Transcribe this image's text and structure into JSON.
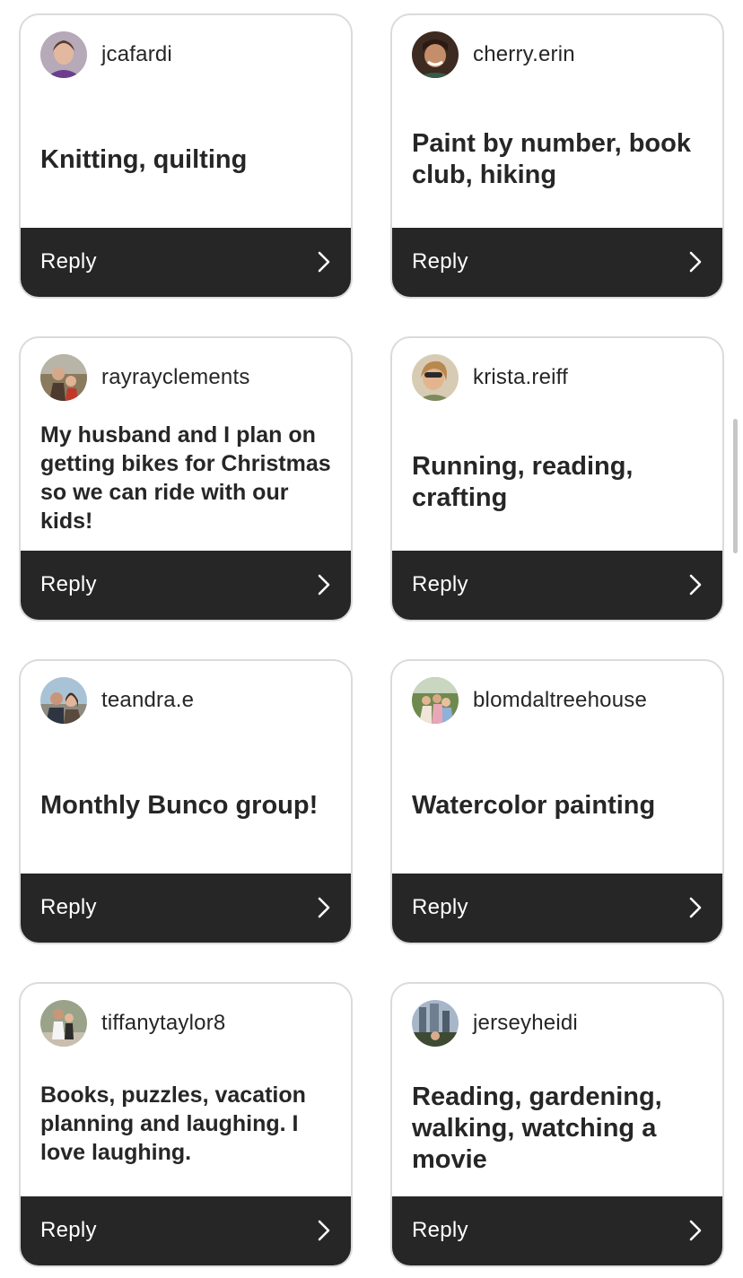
{
  "reply_label": "Reply",
  "colors": {
    "reply_bar": "#262626",
    "card_border": "#dbdbdb",
    "text": "#262626"
  },
  "cards": [
    {
      "username": "jcafardi",
      "message": "Knitting, quilting",
      "avatar_icon": "user-avatar"
    },
    {
      "username": "cherry.erin",
      "message": "Paint by number, book club, hiking",
      "avatar_icon": "user-avatar"
    },
    {
      "username": "rayrayclements",
      "message": "My husband and I plan on getting bikes for Christmas so we can ride with our kids!",
      "avatar_icon": "user-avatar"
    },
    {
      "username": "krista.reiff",
      "message": "Running, reading, crafting",
      "avatar_icon": "user-avatar"
    },
    {
      "username": "teandra.e",
      "message": "Monthly Bunco group!",
      "avatar_icon": "user-avatar"
    },
    {
      "username": "blomdaltreehouse",
      "message": "Watercolor painting",
      "avatar_icon": "user-avatar"
    },
    {
      "username": "tiffanytaylor8",
      "message": "Books, puzzles, vacation planning and laughing. I love laughing.",
      "avatar_icon": "user-avatar"
    },
    {
      "username": "jerseyheidi",
      "message": "Reading, gardening, walking, watching a movie",
      "avatar_icon": "user-avatar"
    }
  ]
}
